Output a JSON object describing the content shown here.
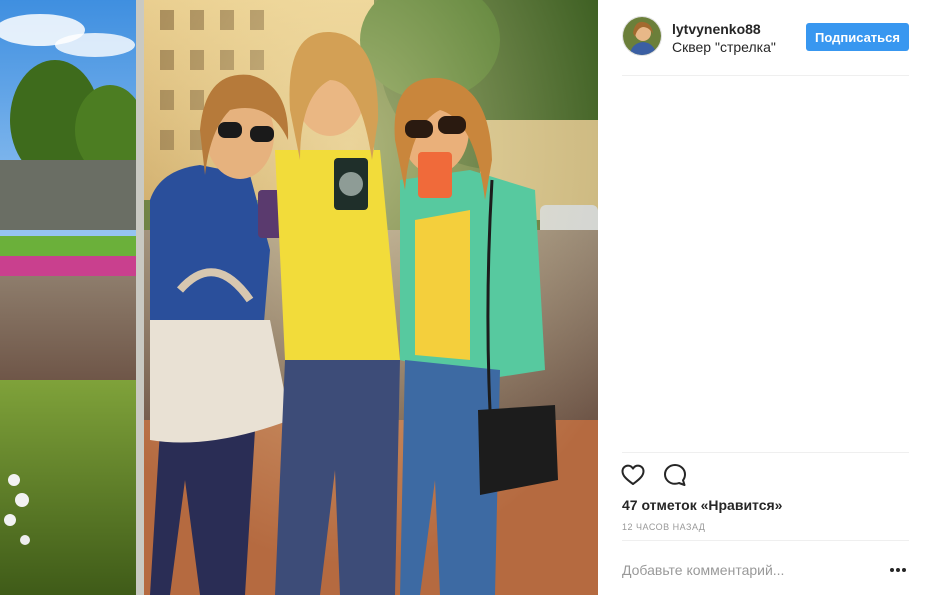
{
  "post": {
    "image": {
      "description": "Three women taking a mirror selfie with smartphones in a sunny city square"
    },
    "header": {
      "username": "lytvynenko88",
      "location": "Сквер \"стрелка\"",
      "follow_label": "Подписаться",
      "avatar_icon": "profile-avatar"
    },
    "actions": {
      "like_icon": "heart-icon",
      "comment_icon": "comment-bubble-icon"
    },
    "likes_text": "47 отметок «Нравится»",
    "timestamp": "12 часов назад",
    "comment": {
      "placeholder": "Добавьте комментарий...",
      "value": ""
    },
    "more_icon": "ellipsis-icon"
  },
  "colors": {
    "follow_button": "#3897f0",
    "text": "#262626",
    "muted": "#999999",
    "divider": "#efefef"
  }
}
